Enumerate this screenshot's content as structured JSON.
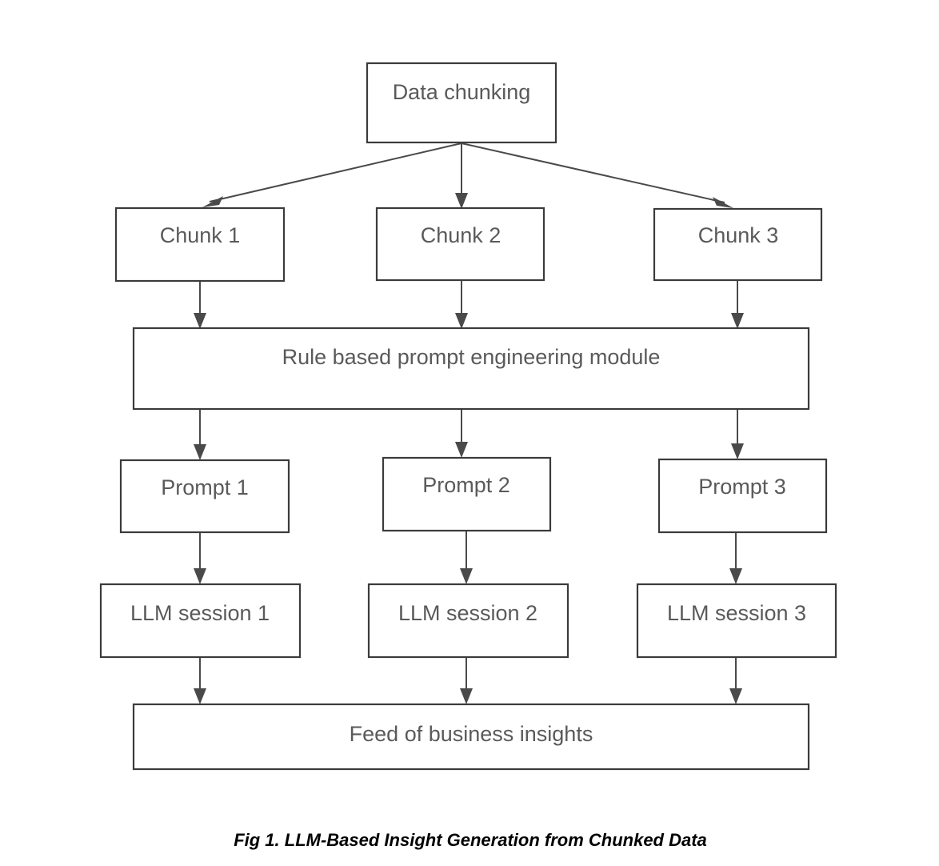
{
  "figure": {
    "caption": "Fig 1. LLM-Based Insight Generation from Chunked Data",
    "background_color": "#ffffff",
    "box_stroke_color": "#3b3b3b",
    "box_fill_color": "#ffffff",
    "label_text_color": "#5a5a5a",
    "arrow_color": "#4a4a4a",
    "caption_text_color": "#000000"
  },
  "nodes": {
    "source": {
      "label": "Data chunking"
    },
    "chunks": [
      {
        "label": "Chunk 1"
      },
      {
        "label": "Chunk 2"
      },
      {
        "label": "Chunk 3"
      }
    ],
    "module": {
      "label": "Rule based prompt engineering module"
    },
    "prompts": [
      {
        "label": "Prompt 1"
      },
      {
        "label": "Prompt 2"
      },
      {
        "label": "Prompt 3"
      }
    ],
    "sessions": [
      {
        "label": "LLM session 1"
      },
      {
        "label": "LLM session 2"
      },
      {
        "label": "LLM session 3"
      }
    ],
    "output": {
      "label": "Feed of business insights"
    }
  },
  "edges": [
    {
      "from": "Data chunking",
      "to": "Chunk 1",
      "style": "diagonal-arrow"
    },
    {
      "from": "Data chunking",
      "to": "Chunk 2",
      "style": "vertical-arrow"
    },
    {
      "from": "Data chunking",
      "to": "Chunk 3",
      "style": "diagonal-arrow"
    },
    {
      "from": "Chunk 1",
      "to": "Rule based prompt engineering module",
      "style": "vertical-arrow"
    },
    {
      "from": "Chunk 2",
      "to": "Rule based prompt engineering module",
      "style": "vertical-arrow"
    },
    {
      "from": "Chunk 3",
      "to": "Rule based prompt engineering module",
      "style": "vertical-arrow"
    },
    {
      "from": "Rule based prompt engineering module",
      "to": "Prompt 1",
      "style": "vertical-arrow"
    },
    {
      "from": "Rule based prompt engineering module",
      "to": "Prompt 2",
      "style": "vertical-arrow"
    },
    {
      "from": "Rule based prompt engineering module",
      "to": "Prompt 3",
      "style": "vertical-arrow"
    },
    {
      "from": "Prompt 1",
      "to": "LLM session 1",
      "style": "vertical-arrow"
    },
    {
      "from": "Prompt 2",
      "to": "LLM session 2",
      "style": "vertical-arrow"
    },
    {
      "from": "Prompt 3",
      "to": "LLM session 3",
      "style": "vertical-arrow"
    },
    {
      "from": "LLM session 1",
      "to": "Feed of business insights",
      "style": "vertical-arrow"
    },
    {
      "from": "LLM session 2",
      "to": "Feed of business insights",
      "style": "vertical-arrow"
    },
    {
      "from": "LLM session 3",
      "to": "Feed of business insights",
      "style": "vertical-arrow"
    }
  ]
}
